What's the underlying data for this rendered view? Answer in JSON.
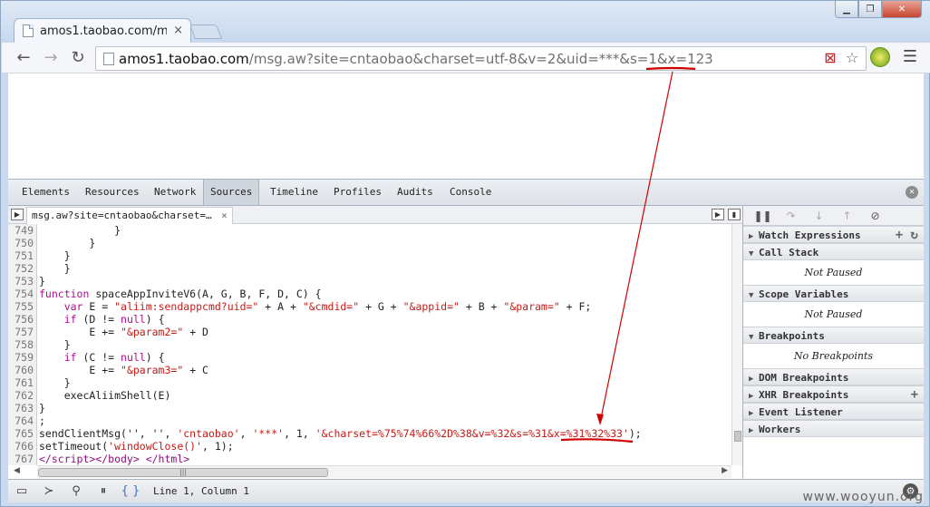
{
  "browser": {
    "tab_title": "amos1.taobao.com/msg",
    "tab_close": "×",
    "url_host": "amos1.taobao.com",
    "url_rest": "/msg.aw?site=cntaobao&charset=utf-8&v=2&uid=***&s=1&x=123"
  },
  "devtools": {
    "tabs": [
      "Elements",
      "Resources",
      "Network",
      "Sources",
      "Timeline",
      "Profiles",
      "Audits",
      "Console"
    ],
    "active_tab": "Sources",
    "file_tab": "msg.aw?site=cntaobao&charset=…",
    "code_lines": [
      {
        "n": "749",
        "html": "            }"
      },
      {
        "n": "750",
        "html": "        }"
      },
      {
        "n": "751",
        "html": "    }"
      },
      {
        "n": "752",
        "html": "    }"
      },
      {
        "n": "753",
        "html": "}"
      },
      {
        "n": "754",
        "html": "<span class=\"kw\">function</span> spaceAppInviteV6(A, G, B, F, D, C) {"
      },
      {
        "n": "755",
        "html": "    <span class=\"kw\">var</span> E = <span class=\"str\">\"aliim:sendappcmd?uid=\"</span> + A + <span class=\"str\">\"&amp;cmdid=\"</span> + G + <span class=\"str\">\"&amp;appid=\"</span> + B + <span class=\"str\">\"&amp;param=\"</span> + F;"
      },
      {
        "n": "756",
        "html": "    <span class=\"kw\">if</span> (D != <span class=\"kw\">null</span>) {"
      },
      {
        "n": "757",
        "html": "        E += <span class=\"str\">\"&amp;param2=\"</span> + D"
      },
      {
        "n": "758",
        "html": "    }"
      },
      {
        "n": "759",
        "html": "    <span class=\"kw\">if</span> (C != <span class=\"kw\">null</span>) {"
      },
      {
        "n": "760",
        "html": "        E += <span class=\"str\">\"&amp;param3=\"</span> + C"
      },
      {
        "n": "761",
        "html": "    }"
      },
      {
        "n": "762",
        "html": "    execAliimShell(E)"
      },
      {
        "n": "763",
        "html": "}"
      },
      {
        "n": "764",
        "html": ";"
      },
      {
        "n": "765",
        "html": "sendClientMsg('', '', <span class=\"str\">'cntaobao'</span>, <span class=\"str\">'***'</span>, 1, <span class=\"str\">'&amp;charset=%75%74%66%2D%38&amp;v=%32&amp;s=%31&amp;x=%31%32%33'</span>);"
      },
      {
        "n": "766",
        "html": "setTimeout(<span class=\"str\">'windowClose()'</span>, 1);"
      },
      {
        "n": "767",
        "html": "<span class=\"tag\">&lt;/script&gt;&lt;/body&gt; &lt;/html&gt;</span>"
      }
    ],
    "sidebar": [
      {
        "title": "Watch Expressions",
        "open": false,
        "actions": "+ ↻"
      },
      {
        "title": "Call Stack",
        "open": true,
        "body": "Not Paused"
      },
      {
        "title": "Scope Variables",
        "open": true,
        "body": "Not Paused"
      },
      {
        "title": "Breakpoints",
        "open": true,
        "body": "No Breakpoints"
      },
      {
        "title": "DOM Breakpoints",
        "open": false
      },
      {
        "title": "XHR Breakpoints",
        "open": false,
        "actions": "+"
      },
      {
        "title": "Event Listener",
        "open": false
      },
      {
        "title": "Workers",
        "open": false
      }
    ],
    "cursor_position": "Line 1, Column 1"
  },
  "watermark": "www.wooyun.org",
  "colors": {
    "annotation": "#d00000"
  }
}
